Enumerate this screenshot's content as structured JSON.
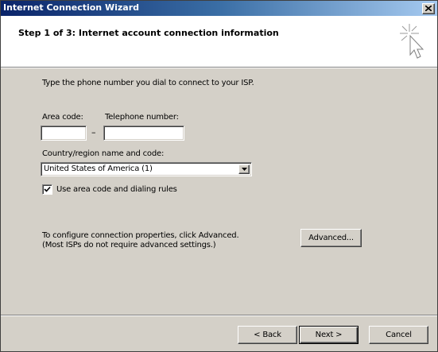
{
  "window": {
    "title": "Internet Connection Wizard",
    "close_glyph": "×"
  },
  "header": {
    "title": "Step 1 of 3: Internet account connection information",
    "icon": "wizard-cursor-icon"
  },
  "content": {
    "instruction": "Type the phone number you dial to connect to your ISP.",
    "area_code_label": "Area code:",
    "telephone_label": "Telephone number:",
    "area_code_value": "",
    "telephone_value": "",
    "dash": "–",
    "country_label": "Country/region name and code:",
    "country_selected": "United States of America (1)",
    "use_area_code_label": "Use area code and dialing rules",
    "use_area_code_checked": true,
    "advanced_text_line1": "To configure connection properties, click Advanced.",
    "advanced_text_line2": "(Most ISPs do not require advanced settings.)",
    "advanced_button": "Advanced..."
  },
  "footer": {
    "back_button": "< Back",
    "next_button": "Next >",
    "cancel_button": "Cancel"
  },
  "colors": {
    "dialog_face": "#d4d0c8",
    "titlebar_start": "#0a246a",
    "titlebar_end": "#a6caf0",
    "header_bg": "#ffffff"
  }
}
